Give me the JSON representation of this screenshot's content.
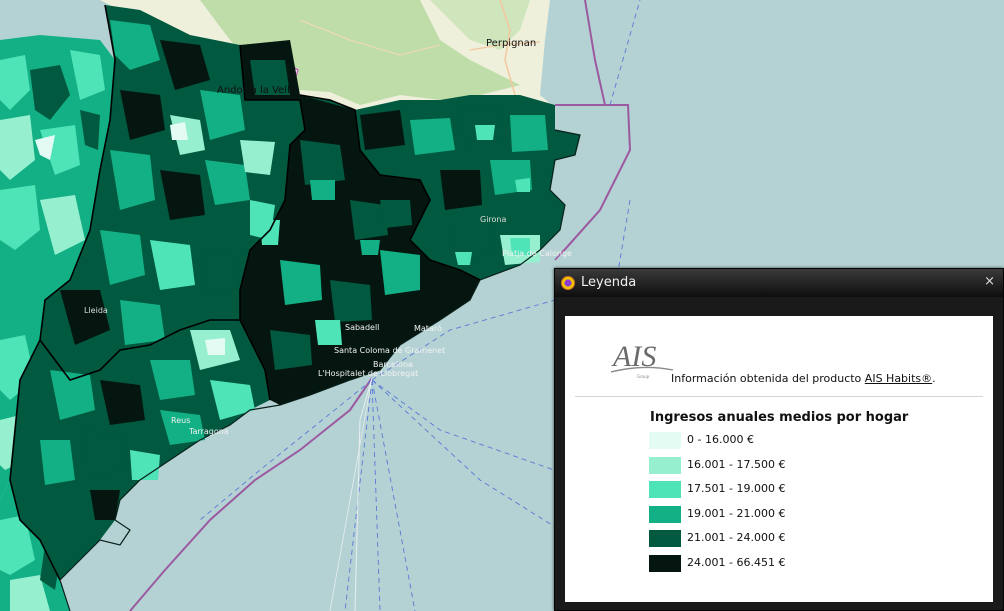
{
  "map": {
    "places": [
      {
        "id": "perpignan",
        "name": "Perpignan"
      },
      {
        "id": "andorra",
        "name": "Andorra la Vella"
      },
      {
        "id": "girona",
        "name": "Girona"
      },
      {
        "id": "calonge",
        "name": "Platja de Calonge"
      },
      {
        "id": "lleida",
        "name": "Lleida"
      },
      {
        "id": "sabadell",
        "name": "Sabadell"
      },
      {
        "id": "mataro",
        "name": "Mataró"
      },
      {
        "id": "santa-coloma",
        "name": "Santa Coloma de Gramenet"
      },
      {
        "id": "barcelona",
        "name": "Barcelona"
      },
      {
        "id": "hospitalet",
        "name": "L'Hospitalet de Llobregat"
      },
      {
        "id": "reus",
        "name": "Reus"
      },
      {
        "id": "tarragona",
        "name": "Tarragona"
      }
    ],
    "colors": {
      "sea": "#b4d2d4",
      "land_france": "#eef0dc",
      "forest_green": "#b5d9a0",
      "border_purple": "#9b5aa0",
      "shipping_lane": "#5a78d6"
    }
  },
  "legend_window": {
    "title": "Leyenda",
    "close_label": "×",
    "source_prefix": "Información obtenida del producto ",
    "source_link": "AIS Habits®",
    "source_suffix": ".",
    "heading": "Ingresos anuales medios por hogar",
    "items": [
      {
        "label": "0 - 16.000 €",
        "color": "#e3fbf3"
      },
      {
        "label": "16.001 - 17.500 €",
        "color": "#96f0cf"
      },
      {
        "label": "17.501 - 19.000 €",
        "color": "#4ee4b8"
      },
      {
        "label": "19.001 - 21.000 €",
        "color": "#12b084"
      },
      {
        "label": "21.001 - 24.000 €",
        "color": "#01593f"
      },
      {
        "label": "24.001 - 66.451 €",
        "color": "#04160f"
      }
    ]
  }
}
